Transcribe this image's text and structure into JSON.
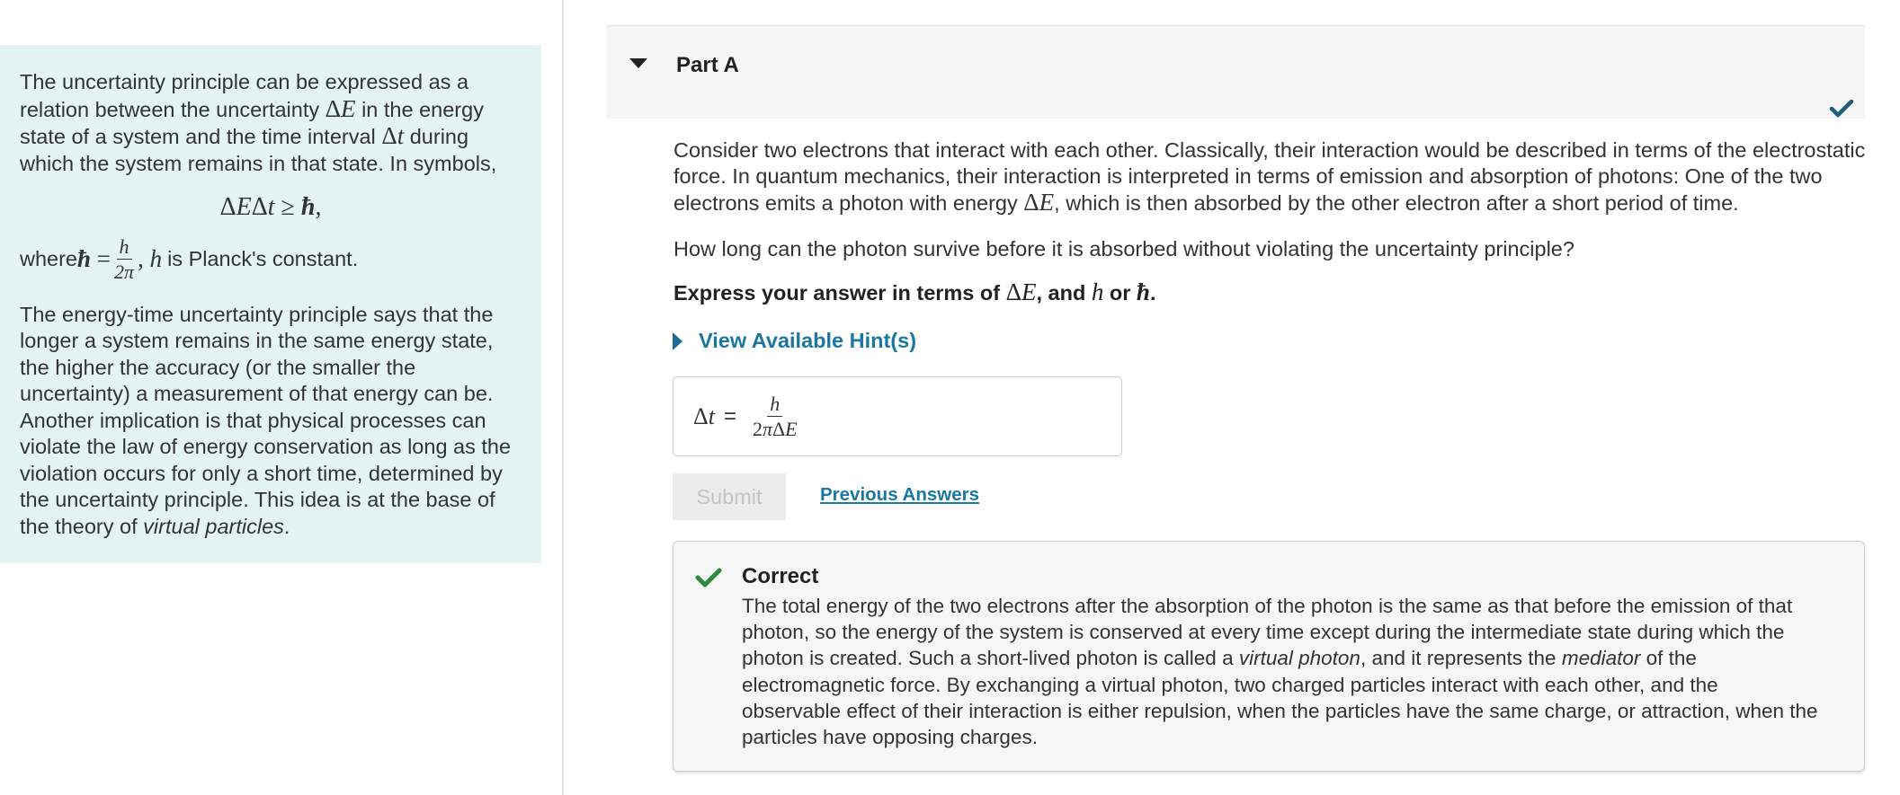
{
  "intro": {
    "p1_a": "The uncertainty principle can be expressed as a relation between the uncertainty ",
    "p1_b": " in the energy state of a system and the time interval ",
    "p1_c": " during which the system remains in that state. In symbols,",
    "where_a": "where ",
    "where_b": " is Planck's constant.",
    "p3_a": "The energy-time uncertainty principle says that the longer a system remains in the same energy state, the higher the accuracy (or the smaller the uncertainty) a measurement of that energy can be. Another implication is that physical processes can violate the law of energy conservation as long as the violation occurs for only a short time, determined by the uncertainty principle. This idea is at the base of the theory of ",
    "p3_em": "virtual particles",
    "p3_end": "."
  },
  "part": {
    "title": "Part A"
  },
  "question": {
    "text1_a": "Consider two electrons that interact with each other. Classically, their interaction would be described in terms of the electrostatic force. In quantum mechanics, their interaction is interpreted in terms of emission and absorption of photons: One of the two electrons emits a photon with energy ",
    "text1_b": ", which is then absorbed by the other electron after a short period of time.",
    "text2": "How long can the photon survive before it is absorbed without violating the uncertainty principle?",
    "instr_a": "Express your answer in terms of ",
    "instr_b": ", and ",
    "instr_c": " or ",
    "instr_d": "."
  },
  "hint": {
    "label": "View Available Hint(s)"
  },
  "answer": {
    "eq": "="
  },
  "buttons": {
    "submit": "Submit",
    "previous_answers": "Previous Answers"
  },
  "feedback": {
    "title": "Correct",
    "body_a": "The total energy of the two electrons after the absorption of the photon is the same as that before the emission of that photon, so the energy of the system is conserved at every time except during the intermediate state during which the photon is created. Such a short-lived photon is called a ",
    "body_em1": "virtual photon",
    "body_b": ", and it represents the ",
    "body_em2": "mediator",
    "body_c": " of the electromagnetic force. By exchanging a virtual photon, two charged particles interact with each other, and the observable effect of their interaction is either repulsion, when the particles have the same charge, or attraction, when the particles have opposing charges."
  },
  "colors": {
    "intro_bg": "#e3f4f3",
    "link": "#1a78a0",
    "check_header": "#1d5f7a",
    "check_correct": "#2e8b3e"
  }
}
